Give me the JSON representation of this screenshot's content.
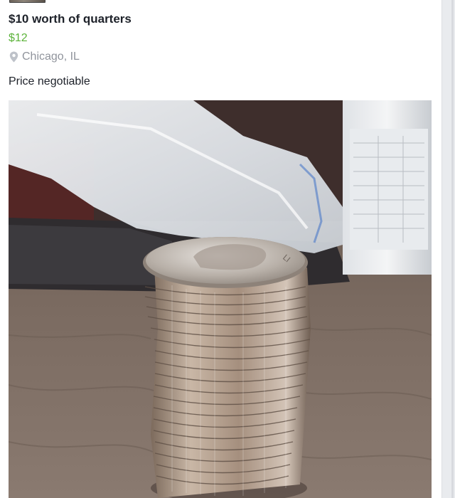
{
  "listing": {
    "title": "$10 worth of quarters",
    "price": "$12",
    "location": "Chicago, IL",
    "description": "Price negotiable"
  },
  "icons": {
    "location": "map-pin-icon"
  },
  "colors": {
    "price": "#5cb33a",
    "title": "#1d2129",
    "secondary_text": "#90949c",
    "page_background": "#e9ebee"
  }
}
